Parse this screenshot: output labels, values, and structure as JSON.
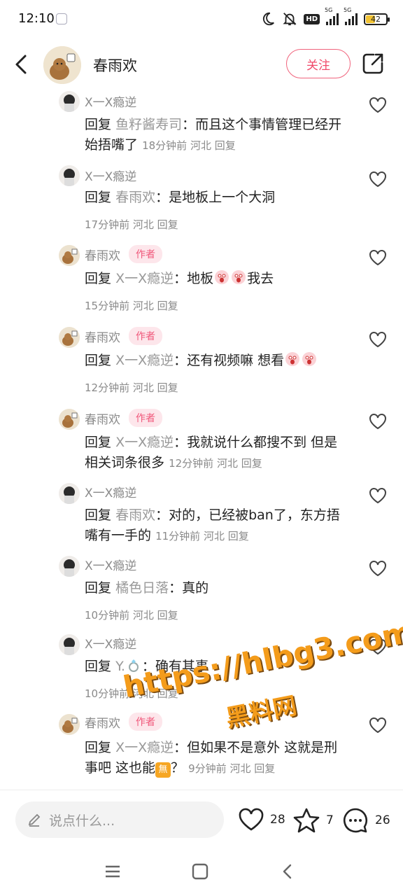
{
  "status_bar": {
    "time": "12:10",
    "hd_label": "HD",
    "network_1": "5G",
    "network_2": "5G",
    "battery": 42
  },
  "header": {
    "name": "春雨欢",
    "follow_label": "关注"
  },
  "comments": [
    {
      "author": "X一X瘾逆",
      "is_author": false,
      "reply_label": "回复",
      "reply_to": "鱼籽酱寿司",
      "text": "而且这个事情管理已经开始捂嘴了",
      "time": "18分钟前",
      "location": "河北",
      "reply_action": "回复"
    },
    {
      "author": "X一X瘾逆",
      "is_author": false,
      "reply_label": "回复",
      "reply_to": "春雨欢",
      "text": "是地板上一个大洞",
      "time": "17分钟前",
      "location": "河北",
      "reply_action": "回复"
    },
    {
      "author": "春雨欢",
      "is_author": true,
      "reply_label": "回复",
      "reply_to": "X一X瘾逆",
      "text_before": "地板",
      "text_after": "我去",
      "time": "15分钟前",
      "location": "河北",
      "reply_action": "回复"
    },
    {
      "author": "春雨欢",
      "is_author": true,
      "reply_label": "回复",
      "reply_to": "X一X瘾逆",
      "text": "还有视频嘛 想看",
      "time": "12分钟前",
      "location": "河北",
      "reply_action": "回复"
    },
    {
      "author": "春雨欢",
      "is_author": true,
      "reply_label": "回复",
      "reply_to": "X一X瘾逆",
      "text": "我就说什么都搜不到 但是相关词条很多",
      "time": "12分钟前",
      "location": "河北",
      "reply_action": "回复"
    },
    {
      "author": "X一X瘾逆",
      "is_author": false,
      "reply_label": "回复",
      "reply_to": "春雨欢",
      "text": "对的，已经被ban了，东方捂嘴有一手的",
      "time": "11分钟前",
      "location": "河北",
      "reply_action": "回复"
    },
    {
      "author": "X一X瘾逆",
      "is_author": false,
      "reply_label": "回复",
      "reply_to": "橘色日落",
      "text": "真的",
      "time": "10分钟前",
      "location": "河北",
      "reply_action": "回复"
    },
    {
      "author": "X一X瘾逆",
      "is_author": false,
      "reply_label": "回复",
      "reply_to": "Y.",
      "text": "确有其事",
      "time": "10分钟前",
      "location": "河北",
      "reply_action": "回复"
    },
    {
      "author": "春雨欢",
      "is_author": true,
      "reply_label": "回复",
      "reply_to": "X一X瘾逆",
      "text_before": "但如果不是意外 这就是刑事吧 这也能",
      "wu_glyph": "無",
      "text_after": "？",
      "time": "9分钟前",
      "location": "河北",
      "reply_action": "回复"
    }
  ],
  "author_badge": "作者",
  "colon": "：",
  "watermark": {
    "url": "https://hlbg3.com",
    "name": "黑料网"
  },
  "bottom_bar": {
    "input_placeholder": "说点什么...",
    "likes": "28",
    "favorites": "7",
    "comments": "26"
  }
}
